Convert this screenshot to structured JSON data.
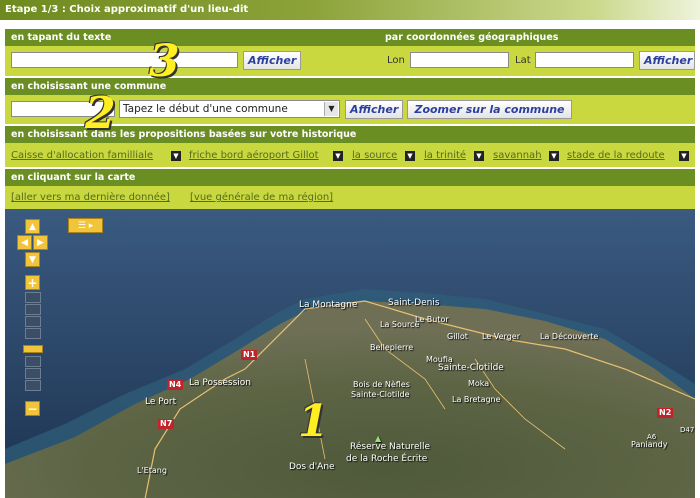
{
  "title": "Etape 1/3 : Choix approximatif d'un lieu-dit",
  "text_section": {
    "header": "en tapant du texte",
    "button": "Afficher"
  },
  "coords_section": {
    "header": "par coordonnées géographiques",
    "lon_label": "Lon",
    "lat_label": "Lat",
    "button": "Afficher"
  },
  "commune_section": {
    "header": "en choisissant une commune",
    "select_value": "Tapez le début d'une commune",
    "afficher_button": "Afficher",
    "zoom_button": "Zoomer sur la commune"
  },
  "history_section": {
    "header": "en choisissant dans les propositions basées sur votre historique",
    "items": [
      "Caisse d'allocation familliale",
      "friche bord aéroport Gillot",
      "la source",
      "la trinité",
      "savannah",
      "stade de la redoute"
    ]
  },
  "map_section": {
    "header": "en cliquant sur la carte",
    "link_last": "[aller vers ma dernière donnée]",
    "link_region": "[vue générale de ma région]"
  },
  "annotations": [
    "3",
    "2",
    "1"
  ],
  "map_labels": {
    "la_montagne": "La Montagne",
    "saint_denis": "Saint-Denis",
    "la_source": "La Source",
    "le_butor": "Le Butor",
    "bellepierre": "Bellepierre",
    "gillot": "Gillot",
    "le_verger": "Le Verger",
    "la_decouverte": "La Découverte",
    "moufia": "Moufia",
    "sainte_clotilde": "Sainte-Clotilde",
    "la_possession": "La Possession",
    "le_port": "Le Port",
    "bois_de_nefles": "Bois de Nèfles",
    "saint_clotilde_small": "Sainte-Clotilde",
    "moka": "Moka",
    "la_bretagne": "La Bretagne",
    "reserve1": "Réserve Naturelle",
    "reserve2": "de la Roche Écrite",
    "dos_dane": "Dos d'Ane",
    "letang": "L'Etang",
    "paniandy": "Paniandy",
    "rn1": "N1",
    "rn4": "N4",
    "rn7": "N7",
    "rn2": "N2",
    "rn3": "A6",
    "rn5": "D47"
  }
}
